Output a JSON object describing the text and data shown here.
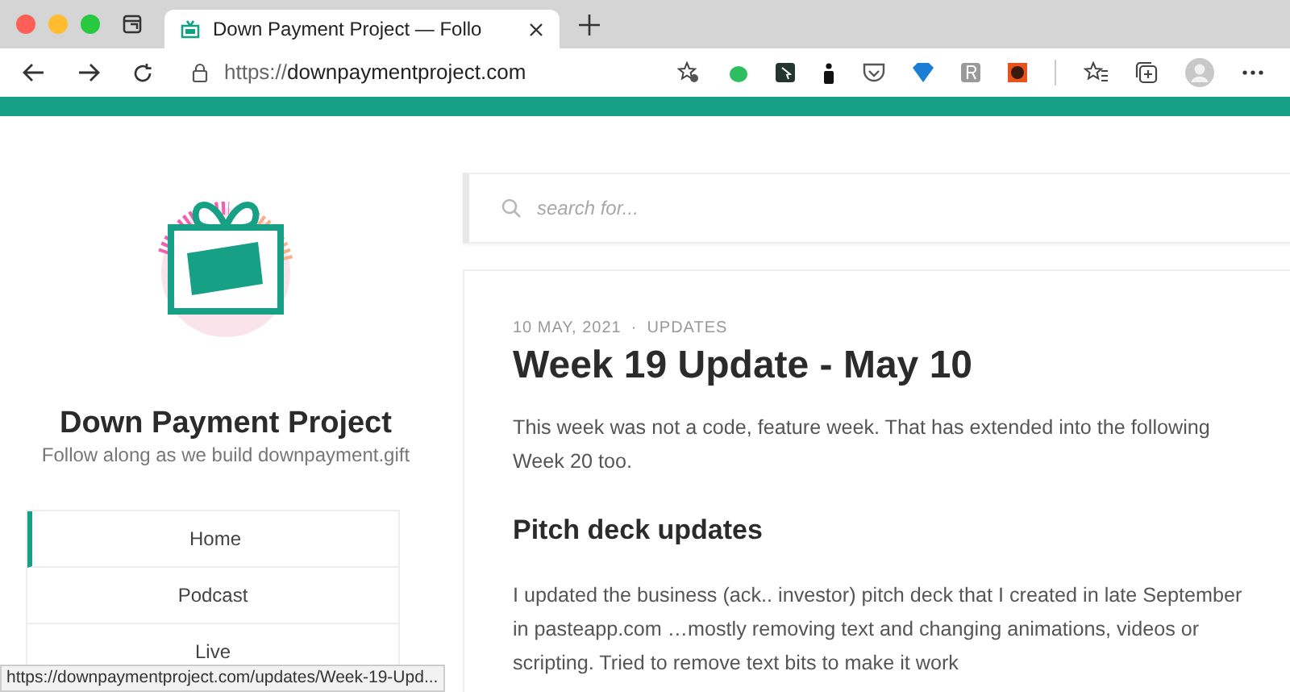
{
  "browser": {
    "tab_title": "Down Payment Project — Follo",
    "url_host": "downpaymentproject.com",
    "url_scheme": "https://",
    "status_url": "https://downpaymentproject.com/updates/Week-19-Upd..."
  },
  "site": {
    "title": "Down Payment Project",
    "tagline": "Follow along as we build downpayment.gift"
  },
  "nav": [
    {
      "label": "Home",
      "selected": true
    },
    {
      "label": "Podcast",
      "selected": false
    },
    {
      "label": "Live",
      "selected": false
    }
  ],
  "search": {
    "placeholder": "search for..."
  },
  "post": {
    "date": "10 MAY, 2021",
    "separator": "·",
    "category": "UPDATES",
    "title": "Week 19 Update - May 10",
    "blocks": [
      {
        "kind": "paragraph",
        "text": "This week was not a code, feature week. That has extended into the following Week 20 too."
      },
      {
        "kind": "heading",
        "text": "Pitch deck updates"
      },
      {
        "kind": "paragraph",
        "text": "I updated the business (ack.. investor) pitch deck that I created in late September in pasteapp.com …mostly removing text and changing animations, videos or scripting. Tried to remove text bits to make it work"
      }
    ]
  }
}
